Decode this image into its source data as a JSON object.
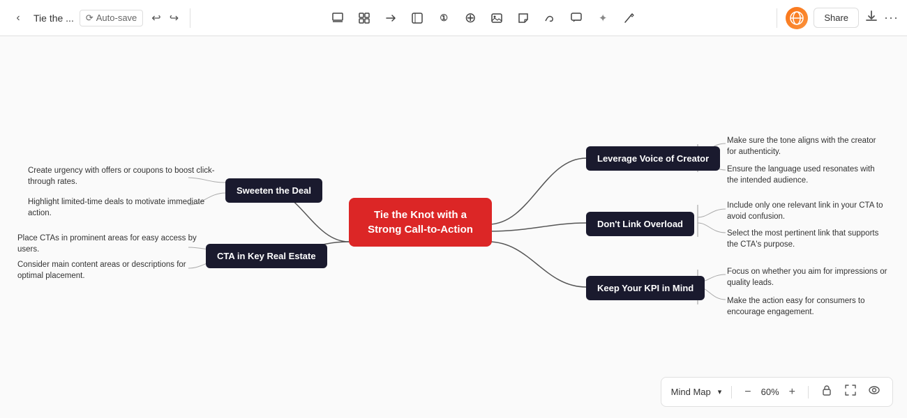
{
  "toolbar": {
    "back_icon": "‹",
    "title": "Tie the ...",
    "autosave_icon": "○",
    "autosave_label": "Auto-save",
    "undo_icon": "↩",
    "redo_icon": "↪",
    "tools": [
      {
        "name": "select-tool",
        "icon": "⬚"
      },
      {
        "name": "frame-tool",
        "icon": "⬛"
      },
      {
        "name": "connect-tool",
        "icon": "⤢"
      },
      {
        "name": "shape-tool",
        "icon": "⬡"
      },
      {
        "name": "text-tool",
        "icon": "①"
      },
      {
        "name": "add-tool",
        "icon": "⊕"
      },
      {
        "name": "image-tool",
        "icon": "▣"
      },
      {
        "name": "sticky-tool",
        "icon": "⬗"
      },
      {
        "name": "draw-tool",
        "icon": "✎"
      },
      {
        "name": "comment-tool",
        "icon": "⬛"
      },
      {
        "name": "ai-tool",
        "icon": "✦"
      },
      {
        "name": "laser-tool",
        "icon": "⚡"
      }
    ],
    "share_label": "Share",
    "download_icon": "⬇",
    "more_icon": "···"
  },
  "mind_map": {
    "central_node": {
      "label": "Tie the Knot with a Strong Call-to-Action"
    },
    "left_nodes": [
      {
        "id": "sweeten",
        "label": "Sweeten the Deal",
        "texts": [
          "Create urgency with offers or coupons to boost click-through rates.",
          "Highlight limited-time deals to motivate immediate action."
        ]
      },
      {
        "id": "cta",
        "label": "CTA in Key Real Estate",
        "texts": [
          "Place CTAs in prominent areas for easy access by users.",
          "Consider main content areas or descriptions for optimal placement."
        ]
      }
    ],
    "right_nodes": [
      {
        "id": "leverage",
        "label": "Leverage Voice of Creator",
        "texts": [
          "Make sure the tone aligns with the creator for authenticity.",
          "Ensure the language used resonates with the intended audience."
        ]
      },
      {
        "id": "nolink",
        "label": "Don't Link Overload",
        "texts": [
          "Include only one relevant link in your CTA to avoid confusion.",
          "Select the most pertinent link that supports the CTA's purpose."
        ]
      },
      {
        "id": "kpi",
        "label": "Keep Your KPI in Mind",
        "texts": [
          "Focus on whether you aim for impressions or quality leads.",
          "Make the action easy for consumers to encourage engagement."
        ]
      }
    ]
  },
  "bottom_bar": {
    "view_label": "Mind Map",
    "zoom_out_icon": "−",
    "zoom_level": "60%",
    "zoom_in_icon": "+",
    "lock_icon": "🔒",
    "fullscreen_icon": "⛶",
    "eye_icon": "◎"
  }
}
